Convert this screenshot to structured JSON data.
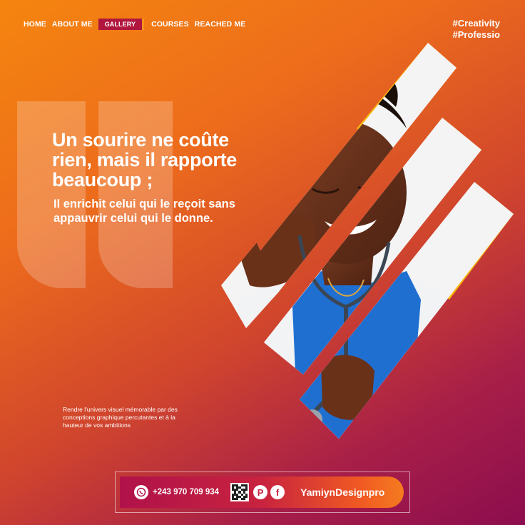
{
  "nav": {
    "items": [
      {
        "label": "HOME",
        "active": false
      },
      {
        "label": "ABOUT ME",
        "active": false
      },
      {
        "label": "GALLERY",
        "active": true
      },
      {
        "label": "COURSES",
        "active": false
      },
      {
        "label": "REACHED ME",
        "active": false
      }
    ]
  },
  "hashtags": [
    "#Creativity",
    "#Professio"
  ],
  "quote": {
    "headline": "Un sourire ne coûte rien, mais il rapporte beaucoup ;",
    "subline": "Il enrichit celui qui le reçoit sans appauvrir celui qui le donne."
  },
  "tagline": "Rendre l'univers visuel mémorable par des conceptions graphique percutantes et à la hauteur de vos ambitions",
  "footer": {
    "phone": "+243 970 709 934",
    "brand": "YamiynDesignpro",
    "icons": [
      "whatsapp-icon",
      "qr-code",
      "pinterest-icon",
      "facebook-icon"
    ]
  },
  "colors": {
    "accent_yellow": "#fbb80f",
    "nav_active": "#b0163e",
    "gradient_start": "#f5850f",
    "gradient_end": "#8c0d4e"
  }
}
